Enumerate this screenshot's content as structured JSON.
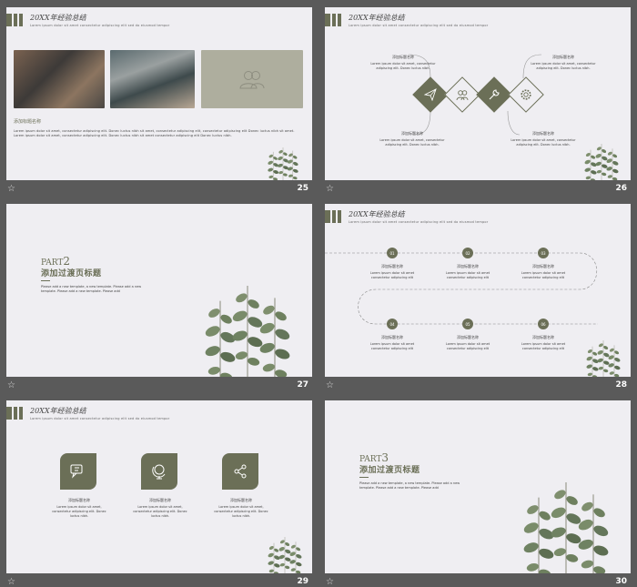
{
  "header": {
    "title": "20XX年经验总结",
    "subtitle": "Lorem ipsum dolor sit amet consectetur adipiscing elit sed do eiusmod tempor"
  },
  "slide_numbers": [
    "25",
    "26",
    "27",
    "28",
    "29",
    "30"
  ],
  "slide25": {
    "label": "添加标题名称",
    "paragraph": "Lorem ipsum dolor sit amet, consectetur adipiscing elit. Donec luctus nibh sit amet, consectetur adipiscing elit, consectetur adipiscing elit Donec luctus nibh sit amet. Lorem ipsum dolor sit amet, consectetur adipiscing elit. Donec luctus nibh sit amet consectetur adipiscing elit Donec luctus nibh."
  },
  "slide26": {
    "items": [
      {
        "title": "添加标题名称",
        "text": "Lorem ipsum dolor sit amet, consectetur adipiscing elit. Donec luctus nibh."
      },
      {
        "title": "添加标题名称",
        "text": "Lorem ipsum dolor sit amet, consectetur adipiscing elit. Donec luctus nibh."
      },
      {
        "title": "添加标题名称",
        "text": "Lorem ipsum dolor sit amet, consectetur adipiscing elit. Donec luctus nibh."
      },
      {
        "title": "添加标题名称",
        "text": "Lorem ipsum dolor sit amet, consectetur adipiscing elit. Donec luctus nibh."
      }
    ]
  },
  "slide27": {
    "part_word": "PART",
    "part_num": "2",
    "title": "添加过渡页标题",
    "desc": "Please add a new template, a new template. Please add a new template. Please add a new template. Please add"
  },
  "slide28": {
    "steps": [
      {
        "num": "01",
        "title": "添加标题名称",
        "text": "Lorem ipsum dolor sit amet consectetur adipiscing elit"
      },
      {
        "num": "02",
        "title": "添加标题名称",
        "text": "Lorem ipsum dolor sit amet consectetur adipiscing elit"
      },
      {
        "num": "03",
        "title": "添加标题名称",
        "text": "Lorem ipsum dolor sit amet consectetur adipiscing elit"
      },
      {
        "num": "04",
        "title": "添加标题名称",
        "text": "Lorem ipsum dolor sit amet consectetur adipiscing elit"
      },
      {
        "num": "05",
        "title": "添加标题名称",
        "text": "Lorem ipsum dolor sit amet consectetur adipiscing elit"
      },
      {
        "num": "06",
        "title": "添加标题名称",
        "text": "Lorem ipsum dolor sit amet consectetur adipiscing elit"
      }
    ]
  },
  "slide29": {
    "items": [
      {
        "title": "添加标题名称",
        "text": "Lorem ipsum dolor sit amet, consectetur adipiscing elit. Donec luctus nibh."
      },
      {
        "title": "添加标题名称",
        "text": "Lorem ipsum dolor sit amet, consectetur adipiscing elit. Donec luctus nibh."
      },
      {
        "title": "添加标题名称",
        "text": "Lorem ipsum dolor sit amet, consectetur adipiscing elit. Donec luctus nibh."
      }
    ]
  },
  "slide30": {
    "part_word": "PART",
    "part_num": "3",
    "title": "添加过渡页标题",
    "desc": "Please add a new template, a new template. Please add a new template. Please add a new template. Please add"
  },
  "colors": {
    "accent": "#6b6f57",
    "slide_bg": "#efeef2",
    "page_bg": "#5a5a5a"
  },
  "icons": [
    "team-icon",
    "paper-plane-icon",
    "users-icon",
    "wrench-icon",
    "gear-icon",
    "chat-icon",
    "globe-icon",
    "share-icon",
    "star-icon"
  ]
}
